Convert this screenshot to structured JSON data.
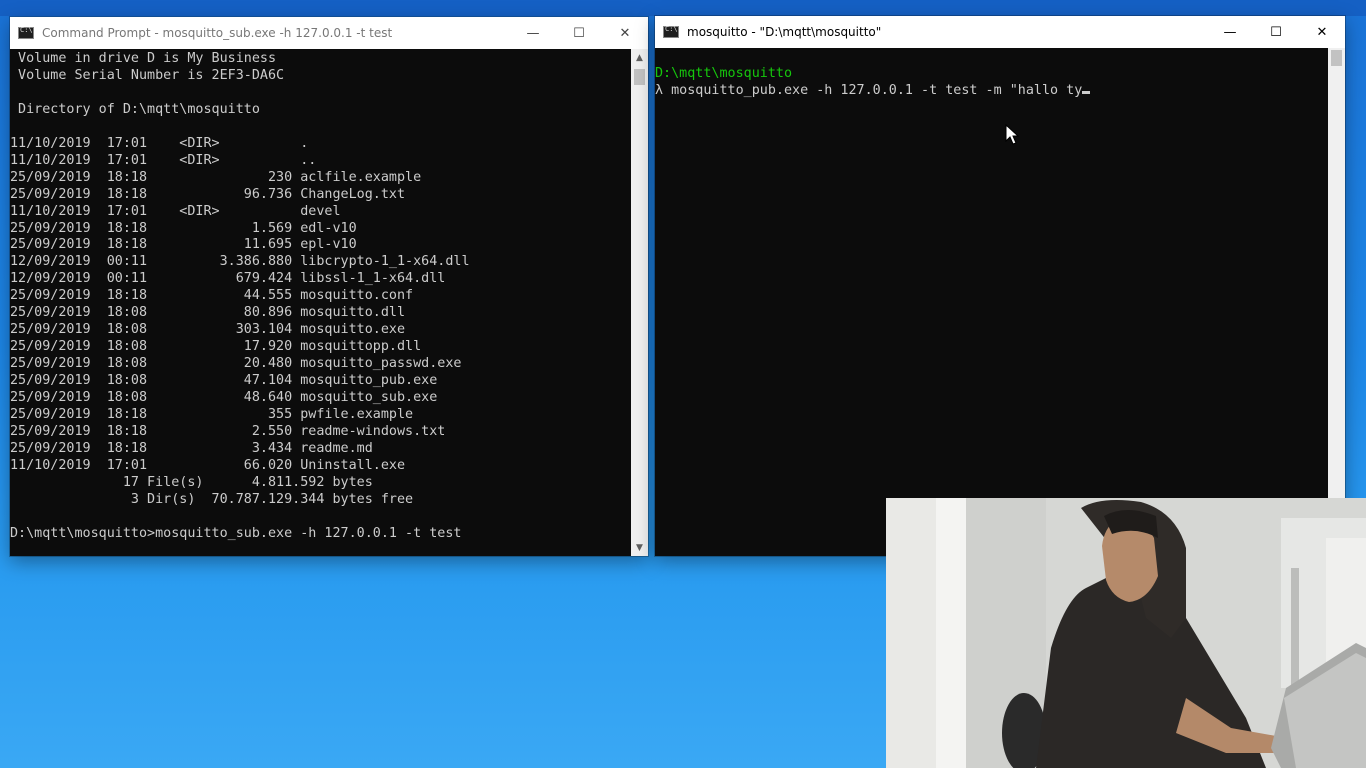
{
  "left_window": {
    "title": "Command Prompt - mosquitto_sub.exe  -h 127.0.0.1 -t test",
    "lines": [
      " Volume in drive D is My Business",
      " Volume Serial Number is 2EF3-DA6C",
      "",
      " Directory of D:\\mqtt\\mosquitto",
      "",
      "11/10/2019  17:01    <DIR>          .",
      "11/10/2019  17:01    <DIR>          ..",
      "25/09/2019  18:18               230 aclfile.example",
      "25/09/2019  18:18            96.736 ChangeLog.txt",
      "11/10/2019  17:01    <DIR>          devel",
      "25/09/2019  18:18             1.569 edl-v10",
      "25/09/2019  18:18            11.695 epl-v10",
      "12/09/2019  00:11         3.386.880 libcrypto-1_1-x64.dll",
      "12/09/2019  00:11           679.424 libssl-1_1-x64.dll",
      "25/09/2019  18:18            44.555 mosquitto.conf",
      "25/09/2019  18:08            80.896 mosquitto.dll",
      "25/09/2019  18:08           303.104 mosquitto.exe",
      "25/09/2019  18:08            17.920 mosquittopp.dll",
      "25/09/2019  18:08            20.480 mosquitto_passwd.exe",
      "25/09/2019  18:08            47.104 mosquitto_pub.exe",
      "25/09/2019  18:08            48.640 mosquitto_sub.exe",
      "25/09/2019  18:18               355 pwfile.example",
      "25/09/2019  18:18             2.550 readme-windows.txt",
      "25/09/2019  18:18             3.434 readme.md",
      "11/10/2019  17:01            66.020 Uninstall.exe",
      "              17 File(s)      4.811.592 bytes",
      "               3 Dir(s)  70.787.129.344 bytes free",
      "",
      "D:\\mqtt\\mosquitto>mosquitto_sub.exe -h 127.0.0.1 -t test"
    ]
  },
  "right_window": {
    "title": "mosquitto - \"D:\\mqtt\\mosquitto\"",
    "path_line": "D:\\mqtt\\mosquitto",
    "command_line": "λ mosquitto_pub.exe -h 127.0.0.1 -t test -m \"hallo ty"
  },
  "window_controls": {
    "minimize": "—",
    "maximize": "☐",
    "close": "✕"
  },
  "colors": {
    "desktop": "#1d86e6",
    "console_bg": "#0c0c0c",
    "console_text": "#cccccc",
    "prompt_path": "#16c60c"
  },
  "icons": {
    "app": "cmd-icon",
    "pointer": "mouse-pointer-icon"
  },
  "webcam": {
    "description_visible": false
  }
}
